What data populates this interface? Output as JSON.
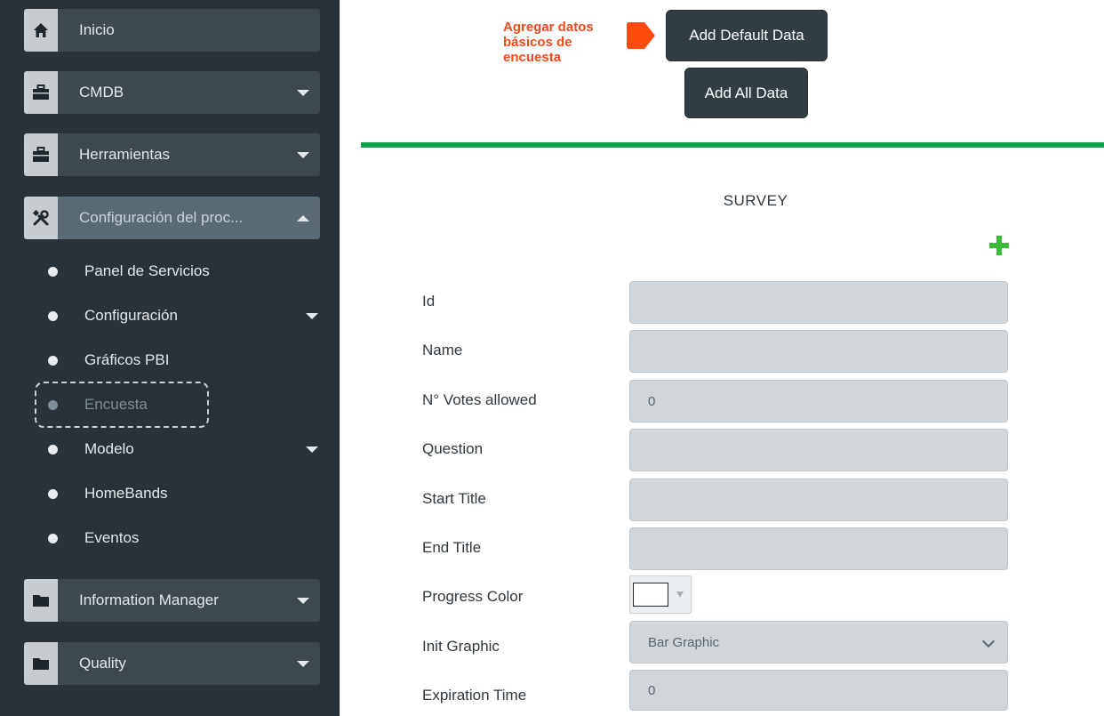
{
  "sidebar": {
    "items": [
      {
        "label": "Inicio",
        "icon": "home-icon"
      },
      {
        "label": "CMDB",
        "icon": "briefcase-icon"
      },
      {
        "label": "Herramientas",
        "icon": "briefcase-icon"
      },
      {
        "label": "Configuración del proc...",
        "icon": "tools-icon"
      },
      {
        "label": "Information Manager",
        "icon": "folder-icon"
      },
      {
        "label": "Quality",
        "icon": "folder-icon"
      }
    ],
    "subitems": [
      {
        "label": "Panel de Servicios"
      },
      {
        "label": "Configuración"
      },
      {
        "label": "Gráficos PBI"
      },
      {
        "label": "Encuesta"
      },
      {
        "label": "Modelo"
      },
      {
        "label": "HomeBands"
      },
      {
        "label": "Eventos"
      }
    ]
  },
  "annotation": {
    "text": "Agregar datos básicos de encuesta",
    "color": "#f24a1d"
  },
  "toolbar": {
    "add_default_label": "Add Default Data",
    "add_all_label": "Add All Data"
  },
  "survey": {
    "title": "SURVEY",
    "fields": [
      {
        "label": "Id",
        "value": ""
      },
      {
        "label": "Name",
        "value": ""
      },
      {
        "label": "N° Votes allowed",
        "value": "0"
      },
      {
        "label": "Question",
        "value": ""
      },
      {
        "label": "Start Title",
        "value": ""
      },
      {
        "label": "End Title",
        "value": ""
      },
      {
        "label": "Progress Color",
        "value": ""
      },
      {
        "label": "Init Graphic",
        "value": "Bar Graphic"
      },
      {
        "label": "Expiration Time",
        "value": "0"
      }
    ]
  },
  "colors": {
    "accent_green": "#11a04c",
    "sidebar_bg": "#293238",
    "button_bg": "#323c43"
  }
}
